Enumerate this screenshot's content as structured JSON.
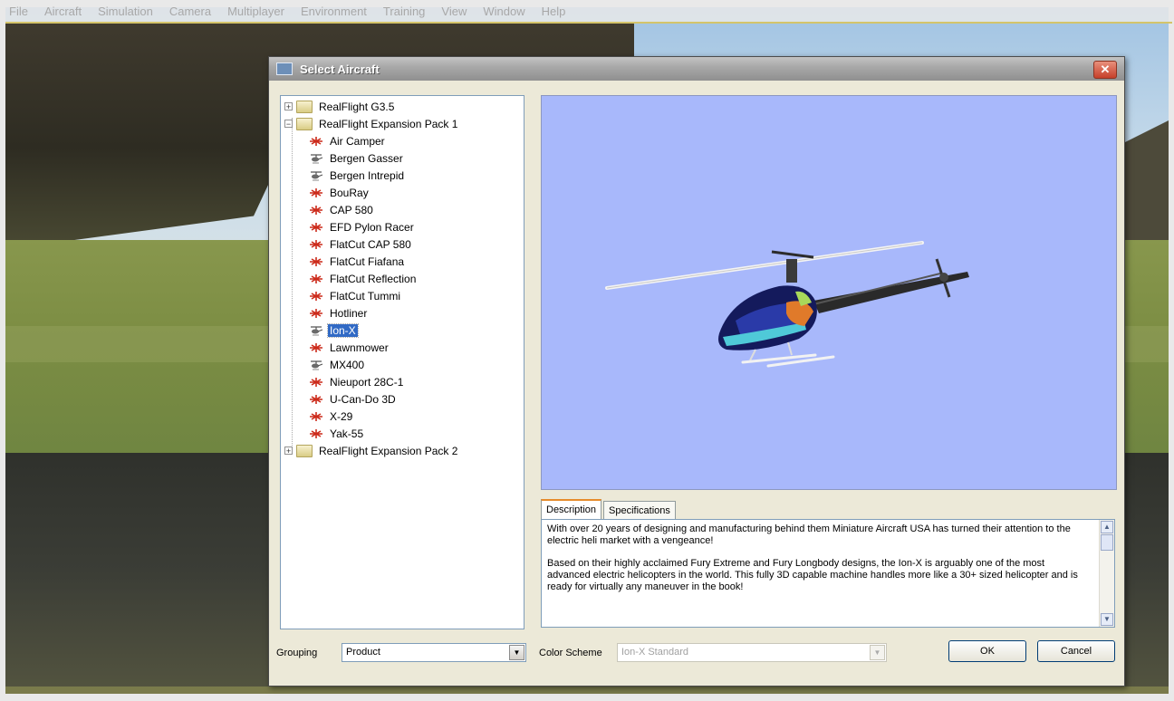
{
  "app_menu": [
    "File",
    "Aircraft",
    "Simulation",
    "Camera",
    "Multiplayer",
    "Environment",
    "Training",
    "View",
    "Window",
    "Help"
  ],
  "dialog": {
    "title": "Select Aircraft",
    "close_label": "✕"
  },
  "tree": {
    "groups": [
      {
        "label": "RealFlight G3.5",
        "expander": "+"
      },
      {
        "label": "RealFlight Expansion Pack 1",
        "expander": "−"
      },
      {
        "label": "RealFlight Expansion Pack 2",
        "expander": "+"
      }
    ],
    "items": [
      {
        "label": "Air Camper",
        "icon": "plane-icon",
        "selected": false
      },
      {
        "label": "Bergen Gasser",
        "icon": "heli-icon",
        "selected": false
      },
      {
        "label": "Bergen Intrepid",
        "icon": "heli-icon",
        "selected": false
      },
      {
        "label": "BouRay",
        "icon": "plane-icon",
        "selected": false
      },
      {
        "label": "CAP 580",
        "icon": "plane-icon",
        "selected": false
      },
      {
        "label": "EFD Pylon Racer",
        "icon": "plane-icon",
        "selected": false
      },
      {
        "label": "FlatCut CAP 580",
        "icon": "plane-icon",
        "selected": false
      },
      {
        "label": "FlatCut Fiafana",
        "icon": "plane-icon",
        "selected": false
      },
      {
        "label": "FlatCut Reflection",
        "icon": "plane-icon",
        "selected": false
      },
      {
        "label": "FlatCut Tummi",
        "icon": "plane-icon",
        "selected": false
      },
      {
        "label": "Hotliner",
        "icon": "plane-icon",
        "selected": false
      },
      {
        "label": "Ion-X",
        "icon": "heli-icon",
        "selected": true
      },
      {
        "label": "Lawnmower",
        "icon": "plane-icon",
        "selected": false
      },
      {
        "label": "MX400",
        "icon": "heli-icon",
        "selected": false
      },
      {
        "label": "Nieuport 28C-1",
        "icon": "plane-icon",
        "selected": false
      },
      {
        "label": "U-Can-Do 3D",
        "icon": "plane-icon",
        "selected": false
      },
      {
        "label": "X-29",
        "icon": "plane-icon",
        "selected": false
      },
      {
        "label": "Yak-55",
        "icon": "plane-icon",
        "selected": false
      }
    ]
  },
  "tabs": [
    {
      "label": "Description",
      "active": true
    },
    {
      "label": "Specifications",
      "active": false
    }
  ],
  "description": {
    "p1": "With over 20 years of designing and manufacturing behind them Miniature Aircraft USA has turned their attention to the electric heli market with a vengeance!",
    "p2": "Based on their highly acclaimed Fury Extreme and Fury Longbody designs, the Ion-X is arguably one of the most advanced electric helicopters in the world. This fully 3D capable machine handles more like a 30+ sized helicopter and is ready for virtually any maneuver in the book!"
  },
  "footer": {
    "grouping_label": "Grouping",
    "grouping_value": "Product",
    "color_scheme_label": "Color Scheme",
    "color_scheme_value": "Ion-X Standard",
    "ok_label": "OK",
    "cancel_label": "Cancel"
  },
  "colors": {
    "preview_bg": "#a8b8fb",
    "selection": "#316ac5",
    "plane_icon": "#cc2a1a"
  }
}
